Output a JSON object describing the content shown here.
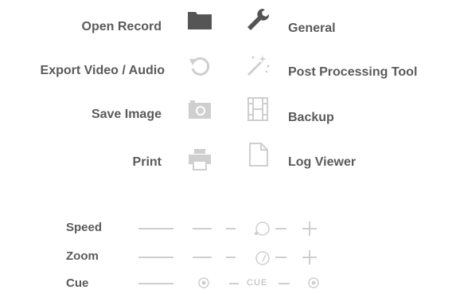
{
  "menu": {
    "left": [
      {
        "label": "Open Record",
        "icon": "folder-icon"
      },
      {
        "label": "Export Video / Audio",
        "icon": "export-rotate-icon"
      },
      {
        "label": "Save Image",
        "icon": "camera-icon"
      },
      {
        "label": "Print",
        "icon": "printer-icon"
      }
    ],
    "right": [
      {
        "label": "General",
        "icon": "wrench-icon"
      },
      {
        "label": "Post Processing Tool",
        "icon": "magic-wand-icon"
      },
      {
        "label": "Backup",
        "icon": "film-icon"
      },
      {
        "label": "Log Viewer",
        "icon": "document-icon"
      }
    ]
  },
  "controls": {
    "speed": {
      "label": "Speed"
    },
    "zoom": {
      "label": "Zoom"
    },
    "cue": {
      "label": "Cue",
      "center_text": "CUE"
    }
  },
  "colors": {
    "label": "#5a5a5a",
    "icon_dark": "#555555",
    "icon_light": "#c8c8c8"
  }
}
